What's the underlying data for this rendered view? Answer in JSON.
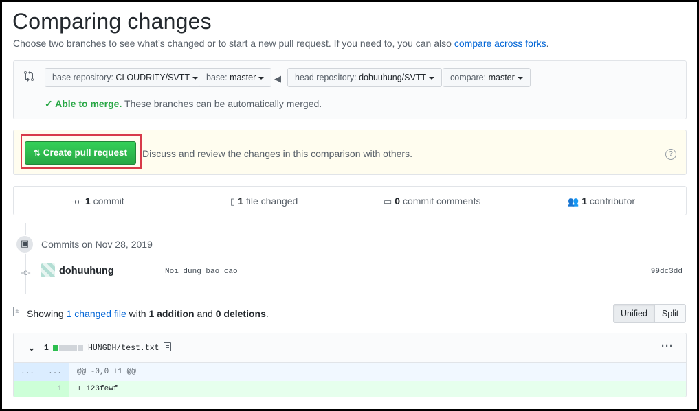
{
  "page": {
    "title": "Comparing changes",
    "subtitle_prefix": "Choose two branches to see what’s changed or to start a new pull request. If you need to, you can also ",
    "subtitle_link": "compare across forks",
    "subtitle_suffix": "."
  },
  "range": {
    "base_repo_label": "base repository: ",
    "base_repo_value": "CLOUDRITY/SVTT",
    "base_label": "base: ",
    "base_value": "master",
    "head_repo_label": "head repository: ",
    "head_repo_value": "dohuuhung/SVTT",
    "compare_label": "compare: ",
    "compare_value": "master",
    "merge_status": "Able to merge.",
    "merge_text": " These branches can be automatically merged."
  },
  "pull_request": {
    "button_label": "Create pull request",
    "description": "Discuss and review the changes in this comparison with others.",
    "help_glyph": "?"
  },
  "stats": {
    "commits_count": "1",
    "commits_label": " commit",
    "files_count": "1",
    "files_label": " file changed",
    "comments_count": "0",
    "comments_label": " commit comments",
    "contributors_count": "1",
    "contributors_label": " contributor"
  },
  "commits": {
    "day_label": "Commits on Nov 28, 2019",
    "items": [
      {
        "author": "dohuuhung",
        "message": "Noi dung bao cao",
        "sha": "99dc3dd"
      }
    ]
  },
  "summary": {
    "prefix": "Showing ",
    "changed_files": "1 changed file",
    "with": " with ",
    "additions": "1 addition",
    "and": " and ",
    "deletions": "0 deletions",
    "end": "."
  },
  "view_toggle": {
    "unified": "Unified",
    "split": "Split"
  },
  "file": {
    "change_count": "1",
    "path": "HUNGDH/test.txt",
    "hunk_left": "...",
    "hunk_right": "...",
    "hunk_header": "@@ -0,0 +1 @@",
    "added_line_number": "1",
    "added_line": "+ 123fewf",
    "diffstat": {
      "additions": 1,
      "neutral": 4
    }
  },
  "colors": {
    "accent": "#0366d6",
    "success": "#28a745",
    "highlight_border": "#d73a49"
  }
}
